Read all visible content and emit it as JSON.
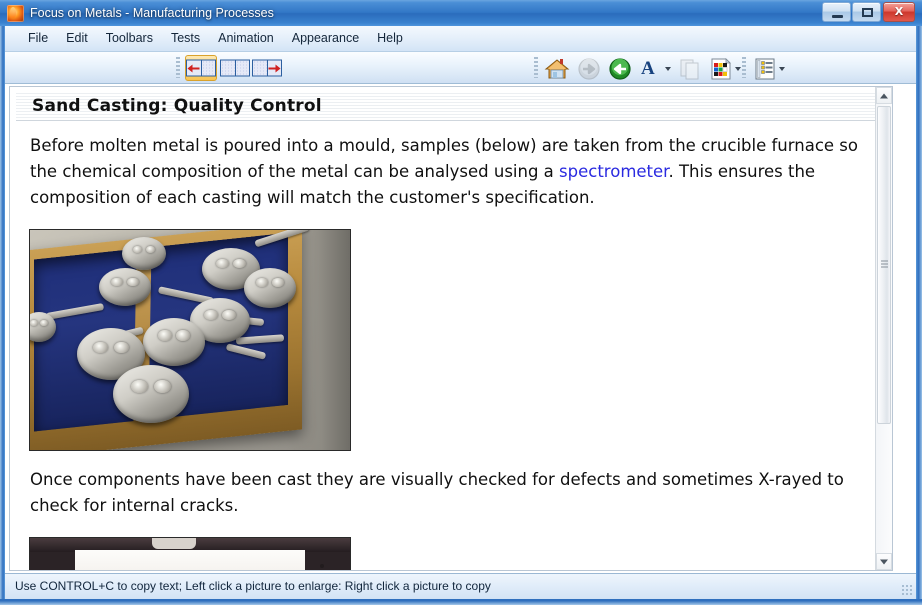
{
  "window": {
    "title": "Focus on Metals - Manufacturing Processes",
    "app_icon": "flame-app-icon",
    "controls": {
      "minimize_label": "Minimize",
      "maximize_label": "Maximize",
      "close_label": "X"
    }
  },
  "menu": {
    "items": [
      {
        "label": "File"
      },
      {
        "label": "Edit"
      },
      {
        "label": "Toolbars"
      },
      {
        "label": "Tests"
      },
      {
        "label": "Animation"
      },
      {
        "label": "Appearance"
      },
      {
        "label": "Help"
      }
    ]
  },
  "toolbar": {
    "left_group": [
      {
        "name": "pane-left-button",
        "icon": "pane-left-arrow-icon",
        "selected": true,
        "title": "Show left pane"
      },
      {
        "name": "pane-split-button",
        "icon": "pane-split-icon",
        "selected": false,
        "title": "Show both panes"
      },
      {
        "name": "pane-right-button",
        "icon": "pane-right-arrow-icon",
        "selected": false,
        "title": "Show right pane"
      }
    ],
    "right_group": [
      {
        "name": "home-button",
        "icon": "home-icon",
        "enabled": true,
        "has_dropdown": false,
        "title": "Home"
      },
      {
        "name": "forward-button",
        "icon": "forward-arrow-icon",
        "enabled": false,
        "has_dropdown": false,
        "title": "Forward"
      },
      {
        "name": "back-button",
        "icon": "back-arrow-icon",
        "enabled": true,
        "has_dropdown": false,
        "title": "Back"
      },
      {
        "name": "font-button",
        "icon": "font-a-icon",
        "enabled": true,
        "has_dropdown": true,
        "label": "A",
        "title": "Font"
      },
      {
        "name": "copy-button",
        "icon": "copy-pages-icon",
        "enabled": false,
        "has_dropdown": false,
        "title": "Copy"
      },
      {
        "name": "colour-button",
        "icon": "colour-palette-page-icon",
        "enabled": true,
        "has_dropdown": true,
        "title": "Colours"
      },
      {
        "name": "list-button",
        "icon": "list-page-icon",
        "enabled": true,
        "has_dropdown": true,
        "title": "Contents list"
      }
    ]
  },
  "document": {
    "heading": "Sand Casting: Quality Control",
    "paragraph_1": {
      "part_1": "Before molten metal is poured into a mould, samples (below) are taken from the crucible furnace so the chemical composition of the metal can be analysed using a ",
      "link": "spectrometer",
      "part_2": ". This ensures the composition of each casting will match the customer's specification."
    },
    "paragraph_2": "Once components have been cast they are visually checked for defects and sometimes X-rayed to check for internal cracks.",
    "images": [
      {
        "name": "photo-metal-samples-in-wooden-crate",
        "alt": "Metal spectrometer sample discs stored in a blue-lined wooden crate"
      },
      {
        "name": "photo-xray-inspection-equipment",
        "alt": "X-ray inspection equipment, partially scrolled out of view"
      }
    ]
  },
  "scrollbar": {
    "orientation": "vertical",
    "up_arrow": "scroll-up-arrow-icon",
    "down_arrow": "scroll-down-arrow-icon"
  },
  "status": {
    "text": "Use CONTROL+C to copy text; Left click a picture to enlarge: Right click a picture to copy"
  },
  "colors": {
    "titlebar_blue": "#3277c6",
    "link_blue": "#2a2ae0",
    "close_red": "#cc372c",
    "selected_toolbar_gold": "#f7c453"
  }
}
